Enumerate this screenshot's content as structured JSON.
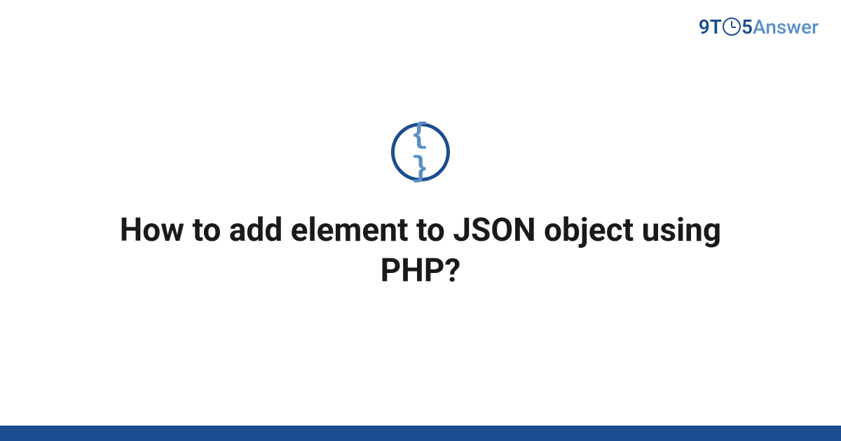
{
  "logo": {
    "part1": "9T",
    "part2": "5",
    "answer": "Answer"
  },
  "icon": {
    "braces": "{ }"
  },
  "title": "How to add element to JSON object using PHP?"
}
